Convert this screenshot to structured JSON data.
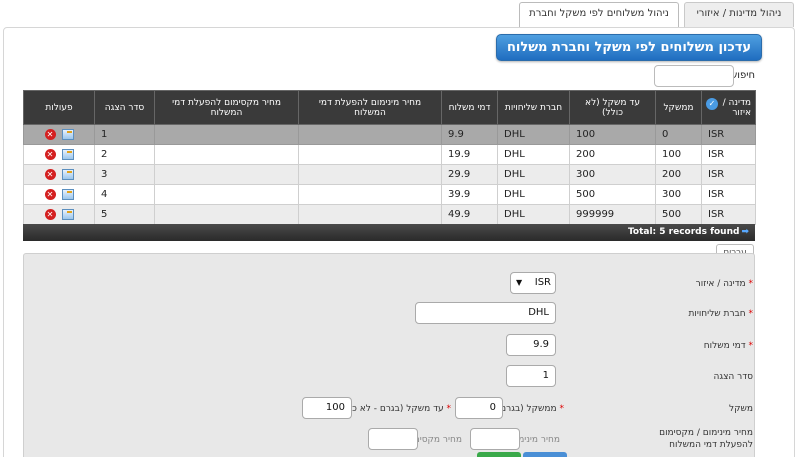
{
  "tabs": [
    {
      "label": "ניהול מדינות / איזורי משלוח",
      "active": false
    },
    {
      "label": "ניהול משלוחים לפי משקל וחברת משלוח",
      "active": true
    }
  ],
  "page_title": "עדכון משלוחים לפי משקל וחברת משלוח",
  "search": {
    "label": "חיפוש:",
    "value": ""
  },
  "table": {
    "columns": [
      "מדינה / איזור",
      "ממשקל",
      "עד משקל (לא כולל)",
      "חברת שליחויות",
      "דמי משלוח",
      "מחיר מינימום להפעלת דמי המשלוח",
      "מחיר מקסימום להפעלת דמי המשלוח",
      "סדר הצגה",
      "פעולות"
    ],
    "rows": [
      {
        "country": "ISR",
        "from": "0",
        "to": "100",
        "company": "DHL",
        "fee": "9.9",
        "min": "",
        "max": "",
        "order": "1"
      },
      {
        "country": "ISR",
        "from": "100",
        "to": "200",
        "company": "DHL",
        "fee": "19.9",
        "min": "",
        "max": "",
        "order": "2"
      },
      {
        "country": "ISR",
        "from": "200",
        "to": "300",
        "company": "DHL",
        "fee": "29.9",
        "min": "",
        "max": "",
        "order": "3"
      },
      {
        "country": "ISR",
        "from": "300",
        "to": "500",
        "company": "DHL",
        "fee": "39.9",
        "min": "",
        "max": "",
        "order": "4"
      },
      {
        "country": "ISR",
        "from": "500",
        "to": "999999",
        "company": "DHL",
        "fee": "49.9",
        "min": "",
        "max": "",
        "order": "5"
      }
    ],
    "footer": "Total: 5 records found"
  },
  "subtab": "ערכים",
  "form": {
    "country_label": "מדינה / איזור",
    "country_value": "ISR",
    "company_label": "חברת שליחויות",
    "company_value": "DHL",
    "fee_label": "דמי משלוח",
    "fee_value": "9.9",
    "order_label": "סדר הצגה",
    "order_value": "1",
    "weight_label": "משקל",
    "from_label": "ממשקל (בגרם)",
    "from_value": "0",
    "to_label": "עד משקל (בגרם - לא כולל)",
    "to_value": "100",
    "minmax_label": "מחיר מינימום / מקסימום להפעלת דמי המשלוח",
    "min_placeholder": "מחיר מינימום",
    "max_placeholder": "מחיר מקסימום",
    "required_mark": "*"
  },
  "icons": {
    "delete": "delete-icon",
    "edit": "edit-icon",
    "check": "check-icon",
    "arrow": "arrow-icon",
    "dropdown": "chevron-down-icon"
  }
}
